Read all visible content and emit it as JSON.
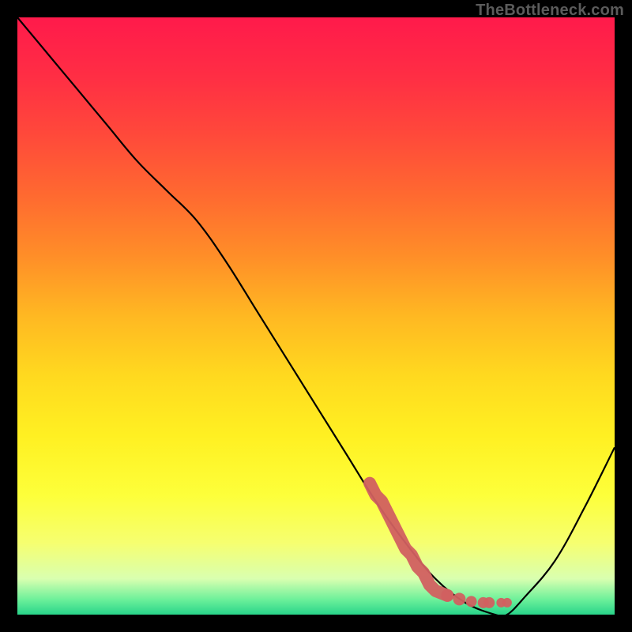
{
  "watermark": "TheBottleneck.com",
  "gradient": {
    "stops": [
      {
        "offset": 0.0,
        "color": "#ff1a4b"
      },
      {
        "offset": 0.1,
        "color": "#ff2e44"
      },
      {
        "offset": 0.2,
        "color": "#ff4a3a"
      },
      {
        "offset": 0.3,
        "color": "#ff6a30"
      },
      {
        "offset": 0.4,
        "color": "#ff8e28"
      },
      {
        "offset": 0.5,
        "color": "#ffb822"
      },
      {
        "offset": 0.6,
        "color": "#ffd91f"
      },
      {
        "offset": 0.7,
        "color": "#fff022"
      },
      {
        "offset": 0.8,
        "color": "#fdff3a"
      },
      {
        "offset": 0.88,
        "color": "#f6ff70"
      },
      {
        "offset": 0.94,
        "color": "#d9ffb0"
      },
      {
        "offset": 0.975,
        "color": "#6cf09a"
      },
      {
        "offset": 1.0,
        "color": "#28d48a"
      }
    ]
  },
  "chart_data": {
    "type": "line",
    "title": "",
    "xlabel": "",
    "ylabel": "",
    "xlim": [
      0,
      100
    ],
    "ylim": [
      0,
      100
    ],
    "series": [
      {
        "name": "curve",
        "color": "#000000",
        "x": [
          0,
          5,
          10,
          15,
          20,
          25,
          30,
          35,
          40,
          45,
          50,
          55,
          60,
          65,
          70,
          75,
          80,
          82,
          85,
          90,
          95,
          100
        ],
        "values": [
          100,
          94,
          88,
          82,
          76,
          71,
          66,
          59,
          51,
          43,
          35,
          27,
          19,
          12,
          6,
          2,
          0,
          0,
          3,
          9,
          18,
          28
        ]
      }
    ],
    "highlight": {
      "name": "optimal-range",
      "color": "#d16060",
      "style": "dotted-thick",
      "x": [
        59,
        60,
        61,
        62,
        63,
        64,
        65,
        66,
        67,
        68,
        69,
        70,
        72,
        74,
        76,
        78,
        79,
        81,
        82
      ],
      "values": [
        22,
        20,
        19,
        17,
        15,
        13,
        11,
        10,
        8,
        7,
        5,
        4,
        3.2,
        2.6,
        2.2,
        2,
        2,
        2,
        2
      ]
    }
  }
}
